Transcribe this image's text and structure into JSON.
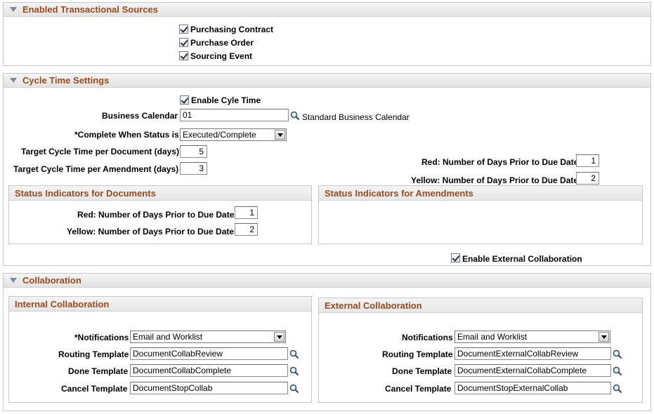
{
  "sources": {
    "title": "Enabled Transactional Sources",
    "items": [
      {
        "label": "Purchasing Contract",
        "checked": true
      },
      {
        "label": "Purchase Order",
        "checked": true
      },
      {
        "label": "Sourcing Event",
        "checked": true
      }
    ]
  },
  "cycle": {
    "title": "Cycle Time Settings",
    "enable_label": "Enable Cyle Time",
    "business_calendar_label": "Business Calendar",
    "business_calendar_value": "01",
    "business_calendar_desc": "Standard Business Calendar",
    "complete_status_label": "*Complete When Status is",
    "complete_status_value": "Executed/Complete",
    "target_doc_label": "Target Cycle Time per Document (days)",
    "target_doc_value": "5",
    "target_amend_label": "Target Cycle Time per Amendment (days)",
    "target_amend_value": "3",
    "right_red_label": "Red: Number of Days Prior to Due Date",
    "right_red_value": "1",
    "right_yellow_label": "Yellow: Number of Days Prior to Due Date",
    "right_yellow_value": "2",
    "docs_box": {
      "title": "Status Indicators for Documents",
      "red_label": "Red: Number of Days Prior to Due Date",
      "red_value": "1",
      "yellow_label": "Yellow: Number of Days Prior to Due Date",
      "yellow_value": "2"
    },
    "amend_box": {
      "title": "Status Indicators for Amendments"
    },
    "external_collab_label": "Enable External Collaboration"
  },
  "collab": {
    "title": "Collaboration",
    "internal": {
      "title": "Internal Collaboration",
      "notifications_label": "*Notifications",
      "notifications_value": "Email and Worklist",
      "routing_label": "Routing Template",
      "routing_value": "DocumentCollabReview",
      "done_label": "Done Template",
      "done_value": "DocumentCollabComplete",
      "cancel_label": "Cancel Template",
      "cancel_value": "DocumentStopCollab"
    },
    "external": {
      "title": "External Collaboration",
      "notifications_label": "Notifications",
      "notifications_value": "Email and Worklist",
      "routing_label": "Routing Template",
      "routing_value": "DocumentExternalCollabReview",
      "done_label": "Done Template",
      "done_value": "DocumentExternalCollabComplete",
      "cancel_label": "Cancel Template",
      "cancel_value": "DocumentStopExternalCollab"
    }
  },
  "icons": {
    "lookup": "magnifier-icon",
    "collapse": "triangle-down-icon",
    "check": "checkmark-icon"
  }
}
